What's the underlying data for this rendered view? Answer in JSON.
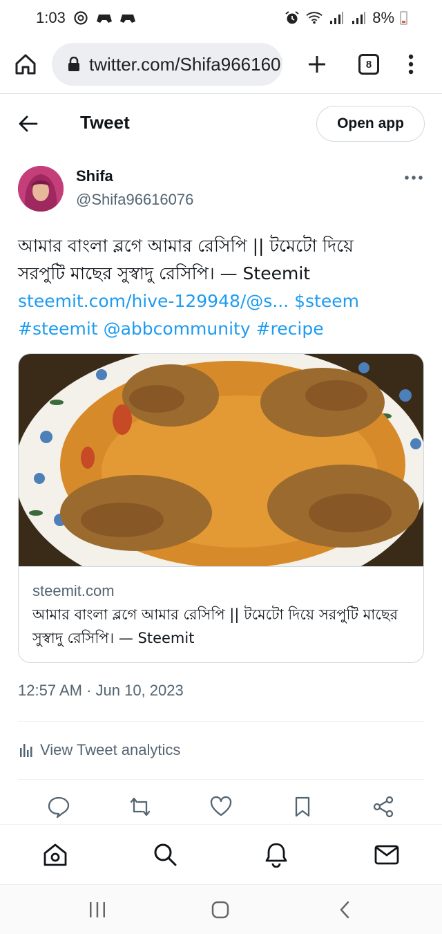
{
  "status_bar": {
    "time": "1:03",
    "battery_percent": "8%",
    "battery_level": 0.08,
    "left_icons": [
      "at-sign-icon",
      "gamepad-icon",
      "gamepad-icon"
    ],
    "right_icons": [
      "alarm-icon",
      "wifi-icon",
      "signal-icon",
      "signal-icon"
    ]
  },
  "browser": {
    "url": "twitter.com/Shifa96616076",
    "tab_count": "8"
  },
  "header": {
    "title": "Tweet",
    "open_app_label": "Open app"
  },
  "tweet": {
    "author_name": "Shifa",
    "author_handle": "@Shifa96616076",
    "text_line1": "আমার বাংলা ব্লগে আমার রেসিপি || টমেটো দিয়ে",
    "text_line2": "সরপুটি মাছের সুস্বাদু রেসিপি। — Steemit",
    "link_url": "steemit.com/hive-129948/@s...",
    "tag_steem": "$steem",
    "tag_steemit": "#steemit",
    "mention": "@abbcommunity",
    "tag_recipe": "#recipe",
    "timestamp": "12:57 AM · Jun 10, 2023",
    "analytics_label": "View Tweet analytics"
  },
  "card": {
    "domain": "steemit.com",
    "title": "আমার বাংলা ব্লগে আমার রেসিপি || টমেটো দিয়ে সরপুটি মাছের সুস্বাদু রেসিপি। — Steemit"
  },
  "actions": [
    "reply-icon",
    "retweet-icon",
    "like-icon",
    "bookmark-icon",
    "share-icon"
  ],
  "bottom_nav": [
    "home-icon",
    "search-icon",
    "notifications-icon",
    "messages-icon"
  ],
  "colors": {
    "link": "#1d9bf0",
    "secondary_text": "#536471",
    "primary_text": "#0f1419",
    "avatar_bg": "#c43e7a"
  }
}
